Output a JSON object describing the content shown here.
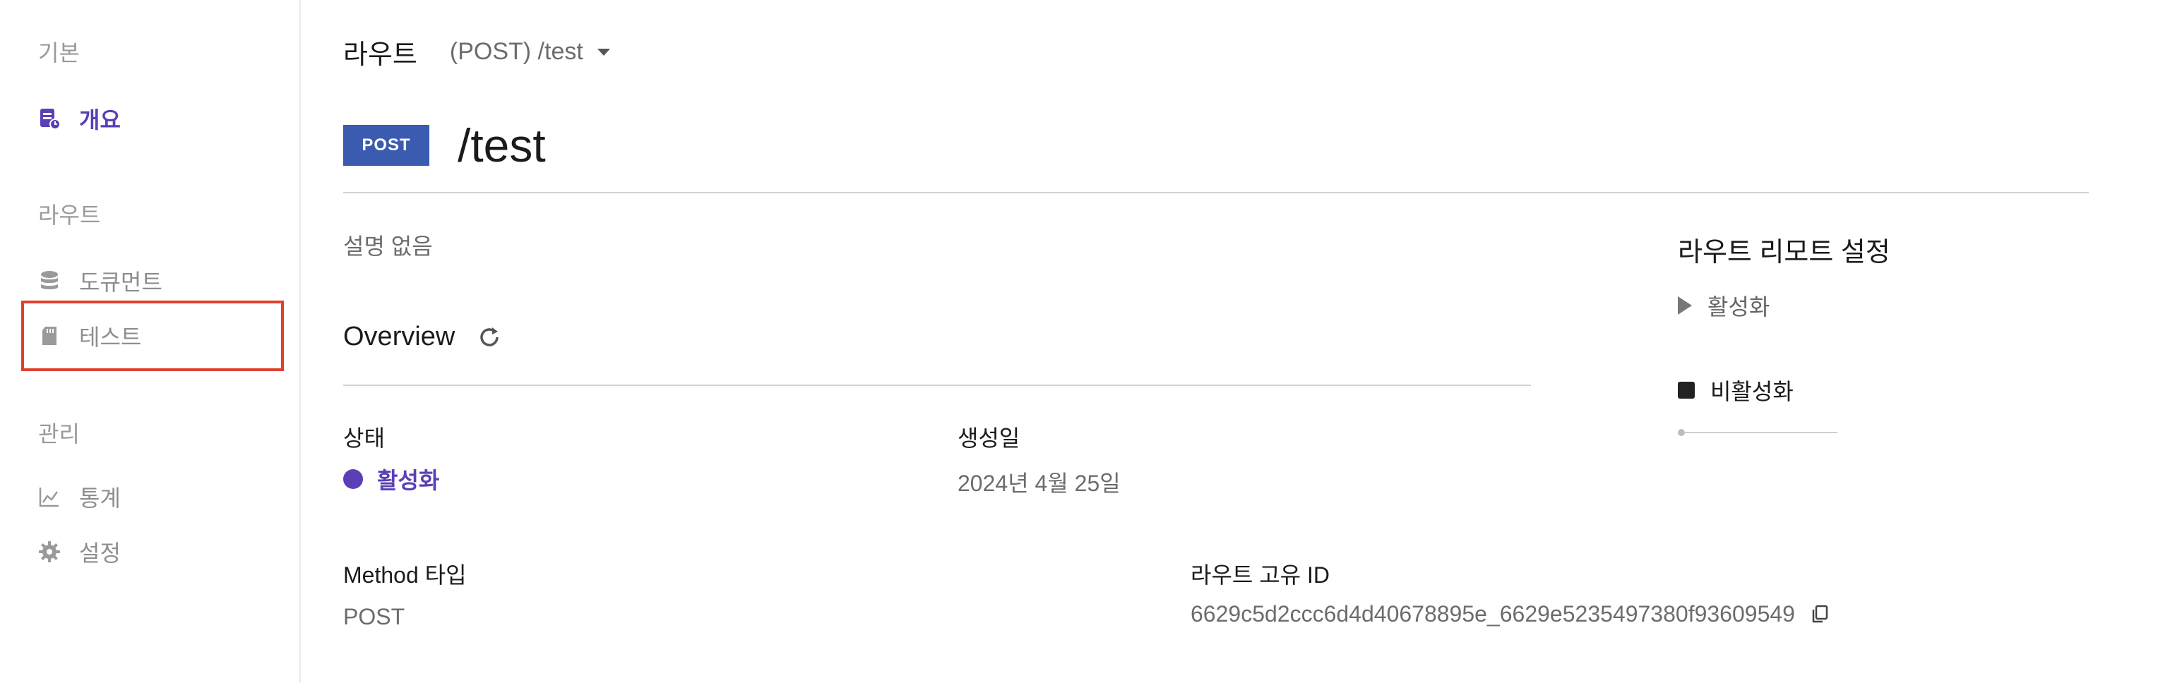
{
  "sidebar": {
    "sections": [
      {
        "title": "기본",
        "items": [
          {
            "label": "개요",
            "icon": "overview-doc-icon",
            "active": true
          }
        ]
      },
      {
        "title": "라우트",
        "items": [
          {
            "label": "도큐먼트",
            "icon": "database-icon"
          },
          {
            "label": "테스트",
            "icon": "sd-card-icon"
          }
        ]
      },
      {
        "title": "관리",
        "items": [
          {
            "label": "통계",
            "icon": "chart-line-icon"
          },
          {
            "label": "설정",
            "icon": "gear-icon"
          }
        ]
      }
    ]
  },
  "topbar": {
    "title": "라우트",
    "route_select": "(POST) /test"
  },
  "route": {
    "method": "POST",
    "path": "/test",
    "description": "설명 없음"
  },
  "overview": {
    "title": "Overview",
    "status_label": "상태",
    "status_value": "활성화",
    "created_label": "생성일",
    "created_value": "2024년 4월 25일",
    "method_label": "Method 타입",
    "method_value": "POST",
    "id_label": "라우트 고유 ID",
    "id_value": "6629c5d2ccc6d4d40678895e_6629e5235497380f93609549"
  },
  "remote": {
    "title": "라우트 리모트 설정",
    "activate_label": "활성화",
    "deactivate_label": "비활성화"
  },
  "colors": {
    "accent": "#5a3fb5",
    "method_badge": "#3a5bb0",
    "highlight": "#e0412e"
  }
}
